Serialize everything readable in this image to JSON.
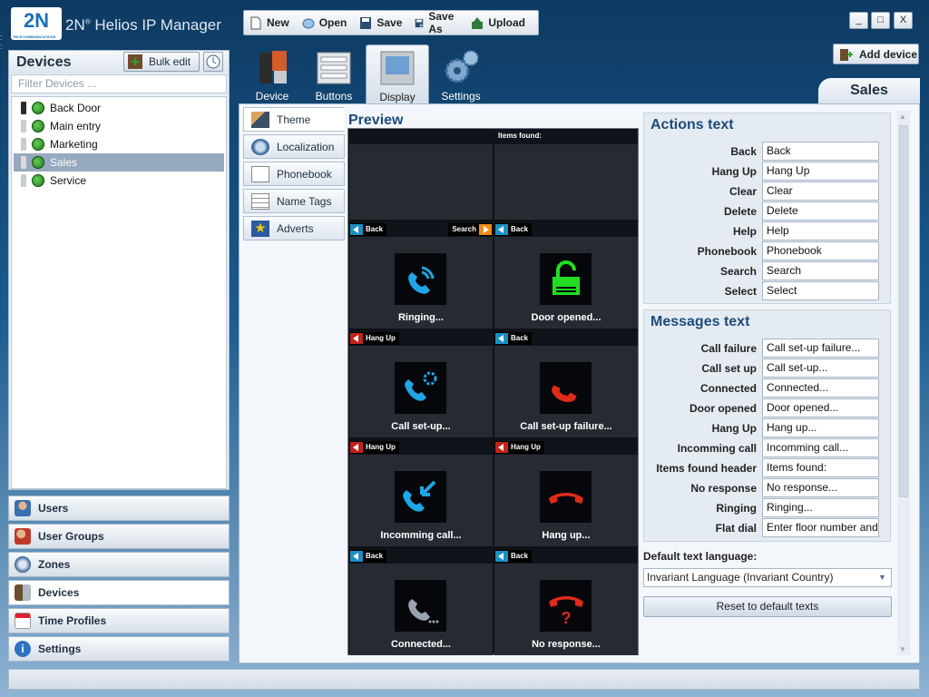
{
  "app": {
    "logo": "2N",
    "logo_sub": "TELECOMMUNICATIONS",
    "title": "2N",
    "title_sup": "®",
    "title_rest": " Helios IP Manager"
  },
  "toolbar": {
    "new": "New",
    "open": "Open",
    "save": "Save",
    "save_as": "Save As",
    "upload": "Upload"
  },
  "window": {
    "minimize": "_",
    "maximize": "□",
    "close": "X"
  },
  "add_device": "Add device",
  "devices_panel": {
    "title": "Devices",
    "bulk_edit": "Bulk edit",
    "filter_placeholder": "Filter Devices ...",
    "items": [
      {
        "label": "Back Door"
      },
      {
        "label": "Main entry"
      },
      {
        "label": "Marketing"
      },
      {
        "label": "Sales"
      },
      {
        "label": "Service"
      }
    ]
  },
  "nav": {
    "users": "Users",
    "user_groups": "User Groups",
    "zones": "Zones",
    "devices": "Devices",
    "time_profiles": "Time Profiles",
    "settings": "Settings"
  },
  "tabs": {
    "device": "Device",
    "buttons": "Buttons",
    "display": "Display",
    "settings": "Settings"
  },
  "current_device": "Sales",
  "side_tabs": {
    "theme": "Theme",
    "localization": "Localization",
    "phonebook": "Phonebook",
    "name_tags": "Name Tags",
    "adverts": "Adverts"
  },
  "preview": {
    "title": "Preview",
    "items_found": "Items found:",
    "cells": [
      {
        "btn1": "Back",
        "btn2": "Search",
        "label": "Ringing..."
      },
      {
        "btn1": "Back",
        "label": "Door opened..."
      },
      {
        "btn1": "Hang Up",
        "label": "Call set-up..."
      },
      {
        "btn1": "Back",
        "label": "Call set-up failure..."
      },
      {
        "btn1": "Hang Up",
        "label": "Incomming call..."
      },
      {
        "btn1": "Hang Up",
        "label": "Hang up..."
      },
      {
        "btn1": "Back",
        "label": "Connected..."
      },
      {
        "btn1": "Back",
        "label": "No response..."
      }
    ]
  },
  "actions_text": {
    "title": "Actions text",
    "rows": [
      {
        "label": "Back",
        "value": "Back"
      },
      {
        "label": "Hang Up",
        "value": "Hang Up"
      },
      {
        "label": "Clear",
        "value": "Clear"
      },
      {
        "label": "Delete",
        "value": "Delete"
      },
      {
        "label": "Help",
        "value": "Help"
      },
      {
        "label": "Phonebook",
        "value": "Phonebook"
      },
      {
        "label": "Search",
        "value": "Search"
      },
      {
        "label": "Select",
        "value": "Select"
      }
    ]
  },
  "messages_text": {
    "title": "Messages text",
    "rows": [
      {
        "label": "Call failure",
        "value": "Call set-up failure..."
      },
      {
        "label": "Call set up",
        "value": "Call set-up..."
      },
      {
        "label": "Connected",
        "value": "Connected..."
      },
      {
        "label": "Door opened",
        "value": "Door opened..."
      },
      {
        "label": "Hang Up",
        "value": "Hang up..."
      },
      {
        "label": "Incomming call",
        "value": "Incomming call..."
      },
      {
        "label": "Items found header",
        "value": "Items found:"
      },
      {
        "label": "No response",
        "value": "No response..."
      },
      {
        "label": "Ringing",
        "value": "Ringing..."
      },
      {
        "label": "Flat dial",
        "value": "Enter floor number and"
      }
    ]
  },
  "language": {
    "label": "Default text language:",
    "value": "Invariant Language (Invariant Country)"
  },
  "reset": "Reset to default texts",
  "colors": {
    "accent": "#1e4b7a",
    "preview_bg": "#262b33",
    "icon_blue": "#1ea6e6",
    "icon_red": "#e02b1a",
    "icon_green": "#22dd22",
    "selected": "#97a9bf"
  }
}
